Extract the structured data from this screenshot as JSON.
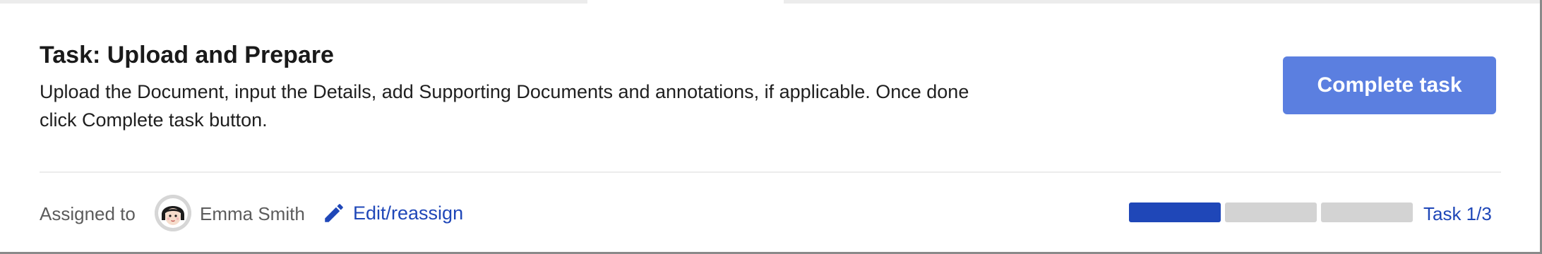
{
  "task": {
    "title": "Task: Upload and Prepare",
    "description": "Upload the Document, input the Details, add Supporting Documents and annotations, if applicable. Once done click Complete task button.",
    "complete_label": "Complete task"
  },
  "assignment": {
    "label": "Assigned to",
    "assignee": "Emma Smith",
    "avatar_icon": "user-avatar-icon",
    "edit_label": "Edit/reassign",
    "edit_icon": "pencil-icon"
  },
  "progress": {
    "completed_steps": 1,
    "total_steps": 3,
    "label": "Task 1/3"
  },
  "colors": {
    "primary_button": "#5b7fe0",
    "link": "#1f47b8",
    "progress_done": "#1f47b8",
    "progress_pending": "#d3d3d3"
  }
}
